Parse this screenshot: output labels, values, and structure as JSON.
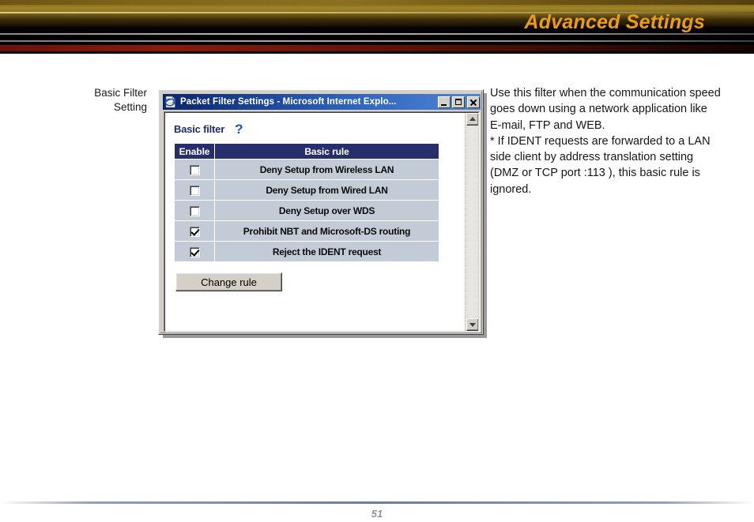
{
  "banner": {
    "title": "Advanced Settings"
  },
  "side_label": {
    "line1": "Basic Filter",
    "line2": "Setting"
  },
  "description": {
    "paragraph1": "Use this filter when the communication speed goes down using a network application like E-mail, FTP and WEB.",
    "paragraph2": "* If IDENT requests are forwarded to a LAN side client by address translation setting (DMZ or TCP port :113 ), this basic rule is ignored."
  },
  "browser_window": {
    "title": "Packet Filter Settings - Microsoft Internet Explo...",
    "app_icon": "internet-explorer-icon",
    "minimize_label": "",
    "maximize_label": "",
    "close_label": "",
    "scroll_up_icon": "scroll-up-arrow-icon",
    "scroll_down_icon": "scroll-down-arrow-icon"
  },
  "page_content": {
    "section_title": "Basic filter",
    "help_icon": "?",
    "table": {
      "headers": [
        "Enable",
        "Basic rule"
      ],
      "rows": [
        {
          "enabled": false,
          "rule": "Deny Setup from Wireless LAN"
        },
        {
          "enabled": false,
          "rule": "Deny Setup from Wired LAN"
        },
        {
          "enabled": false,
          "rule": "Deny Setup over WDS"
        },
        {
          "enabled": true,
          "rule": "Prohibit NBT and Microsoft-DS routing"
        },
        {
          "enabled": true,
          "rule": "Reject the IDENT request"
        }
      ]
    },
    "change_rule_label": "Change rule"
  },
  "footer": {
    "page_number": "51"
  },
  "colors": {
    "banner_gold": "#8a7020",
    "banner_title": "#eb9d16",
    "banner_red": "#8a1b08",
    "table_header_bg": "#262f6b",
    "table_cell_bg": "#c3cbd6",
    "section_title": "#1f2a6b",
    "help_icon": "#1d4fc4",
    "titlebar_start": "#0a246a",
    "titlebar_end": "#4f86d8",
    "window_face": "#d4d0c8",
    "page_number": "#8b949f"
  }
}
